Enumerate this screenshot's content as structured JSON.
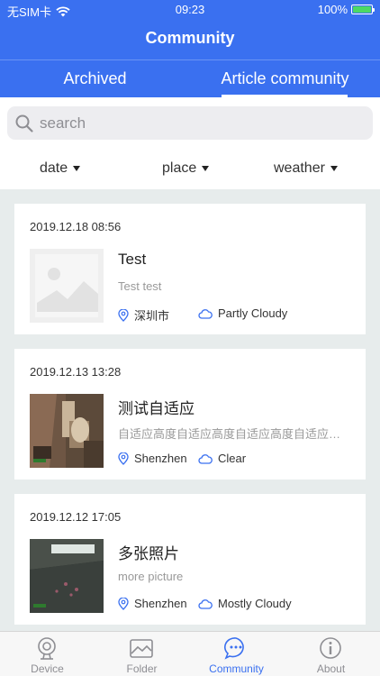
{
  "status_bar": {
    "carrier": "无SIM卡",
    "time": "09:23",
    "battery": "100%"
  },
  "nav": {
    "title": "Community"
  },
  "tabs": [
    {
      "label": "Archived",
      "active": false
    },
    {
      "label": "Article community",
      "active": true
    }
  ],
  "search": {
    "placeholder": "search",
    "value": ""
  },
  "filters": [
    {
      "label": "date"
    },
    {
      "label": "place"
    },
    {
      "label": "weather"
    }
  ],
  "articles": [
    {
      "date": "2019.12.18 08:56",
      "title": "Test",
      "subtitle": "Test test",
      "place": "深圳市",
      "weather": "Partly Cloudy",
      "thumb": "image-placeholder-icon"
    },
    {
      "date": "2019.12.13 13:28",
      "title": "测试自适应",
      "subtitle": "自适应高度自适应高度自适应高度自适应高度自适应高度",
      "place": "Shenzhen",
      "weather": "Clear",
      "thumb": "photo"
    },
    {
      "date": "2019.12.12 17:05",
      "title": "多张照片",
      "subtitle": "more picture",
      "place": "Shenzhen",
      "weather": "Mostly Cloudy",
      "thumb": "photo"
    }
  ],
  "tabbar": [
    {
      "label": "Device",
      "icon": "device-icon",
      "active": false
    },
    {
      "label": "Folder",
      "icon": "folder-icon",
      "active": false
    },
    {
      "label": "Community",
      "icon": "community-icon",
      "active": true
    },
    {
      "label": "About",
      "icon": "about-icon",
      "active": false
    }
  ],
  "colors": {
    "primary": "#3a70f0",
    "feed_bg": "#e7ecec",
    "inactive": "#8e8e93"
  }
}
